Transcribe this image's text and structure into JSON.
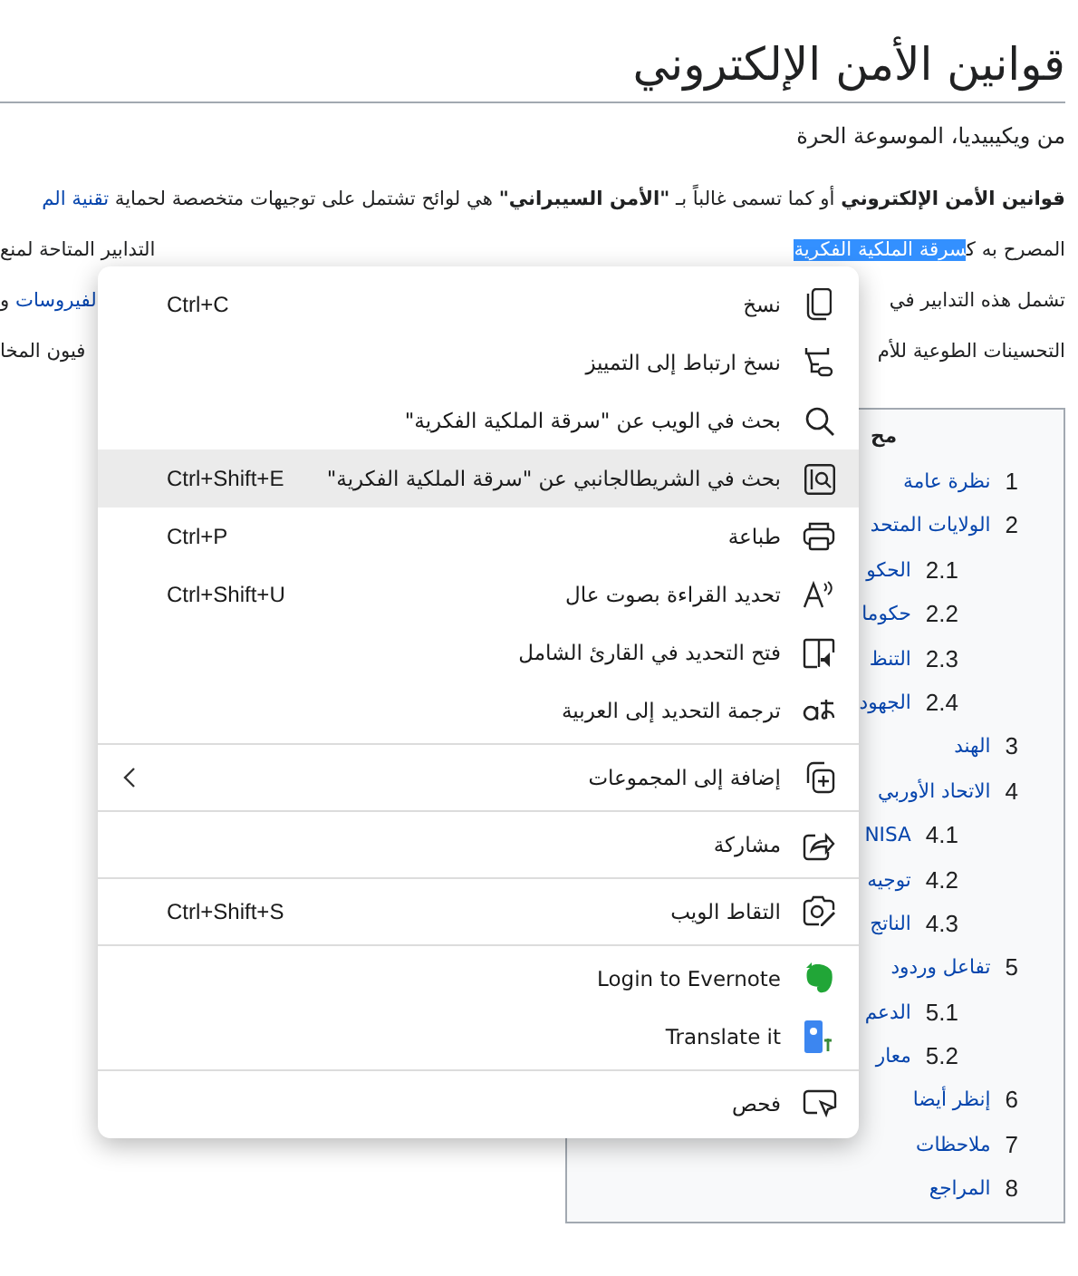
{
  "article": {
    "title": "قوانين الأمن الإلكتروني",
    "subtitle": "من ويكيبيديا، الموسوعة الحرة",
    "lines": [
      {
        "right": [
          {
            "kind": "bold",
            "text": "قوانين الأمن الإلكتروني"
          },
          {
            "kind": "plain",
            "text": " أو كما تسمى غالباً بـ "
          },
          {
            "kind": "bold",
            "text": "\"الأمن السيبراني\""
          },
          {
            "kind": "plain",
            "text": " هي لوائح تشتمل على توجيهات متخصصة لحماية "
          },
          {
            "kind": "link",
            "text": "تقنية الم"
          }
        ]
      },
      {
        "right": [
          {
            "kind": "plain",
            "text": "المصرح به ك"
          },
          {
            "kind": "selected",
            "text": "سرقة الملكية الفكرية"
          }
        ],
        "left": [
          {
            "kind": "plain",
            "text": "التدابير المتاحة لمنع"
          }
        ]
      },
      {
        "right": [
          {
            "kind": "plain",
            "text": "تشمل هذه التدابير في"
          }
        ],
        "left": [
          {
            "kind": "link",
            "text": "لفيروسات"
          },
          {
            "kind": "plain",
            "text": " و"
          }
        ]
      },
      {
        "right": [
          {
            "kind": "plain",
            "text": "التحسينات الطوعية للأم"
          }
        ],
        "left": [
          {
            "kind": "plain",
            "text": "فيون المخا"
          }
        ]
      }
    ]
  },
  "toc": {
    "title": "مح",
    "items": [
      {
        "number": "1",
        "label": "نظرة عامة"
      },
      {
        "number": "2",
        "label": "الولايات المتحد",
        "children": [
          {
            "number": "2.1",
            "label": "الحكو"
          },
          {
            "number": "2.2",
            "label": "حكوما"
          },
          {
            "number": "2.3",
            "label": "التنظ"
          },
          {
            "number": "2.4",
            "label": "الجهود"
          }
        ]
      },
      {
        "number": "3",
        "label": "الهند"
      },
      {
        "number": "4",
        "label": "الاتحاد الأوربي",
        "children": [
          {
            "number": "4.1",
            "label": "NISA"
          },
          {
            "number": "4.2",
            "label": "توجيه"
          },
          {
            "number": "4.3",
            "label": "الناتج"
          }
        ]
      },
      {
        "number": "5",
        "label": "تفاعل وردود",
        "children": [
          {
            "number": "5.1",
            "label": "الدعم"
          },
          {
            "number": "5.2",
            "label": "معار"
          }
        ]
      },
      {
        "number": "6",
        "label": "إنظر أيضا"
      },
      {
        "number": "7",
        "label": "ملاحظات"
      },
      {
        "number": "8",
        "label": "المراجع"
      }
    ]
  },
  "context_menu": {
    "groups": [
      [
        {
          "kind": "copy",
          "label": "نسخ",
          "shortcut": "Ctrl+C",
          "selected": false
        },
        {
          "kind": "copy-link",
          "label": "نسخ ارتباط إلى التمييز",
          "selected": false
        },
        {
          "kind": "search",
          "label": "بحث في الويب عن \"سرقة الملكية الفكرية\"",
          "selected": false
        },
        {
          "kind": "sidebar-search",
          "label": "بحث في الشريطالجانبي عن \"سرقة الملكية الفكرية\"",
          "shortcut": "Ctrl+Shift+E",
          "selected": true
        },
        {
          "kind": "print",
          "label": "طباعة",
          "shortcut": "Ctrl+P",
          "selected": false
        },
        {
          "kind": "read-aloud",
          "label": "تحديد القراءة بصوت عال",
          "shortcut": "Ctrl+Shift+U",
          "selected": false
        },
        {
          "kind": "reader",
          "label": "فتح التحديد في القارئ الشامل",
          "selected": false
        },
        {
          "kind": "translate",
          "label": "ترجمة التحديد إلى العربية",
          "selected": false
        }
      ],
      [
        {
          "kind": "collections",
          "label": "إضافة إلى المجموعات",
          "submenu": true,
          "selected": false
        }
      ],
      [
        {
          "kind": "share",
          "label": "مشاركة",
          "selected": false
        }
      ],
      [
        {
          "kind": "capture",
          "label": "التقاط الويب",
          "shortcut": "Ctrl+Shift+S",
          "selected": false
        }
      ],
      [
        {
          "kind": "evernote",
          "label": "Login to Evernote",
          "selected": false
        },
        {
          "kind": "translator",
          "label": "Translate it",
          "selected": false
        }
      ],
      [
        {
          "kind": "inspect",
          "label": "فحص",
          "selected": false
        }
      ]
    ]
  }
}
